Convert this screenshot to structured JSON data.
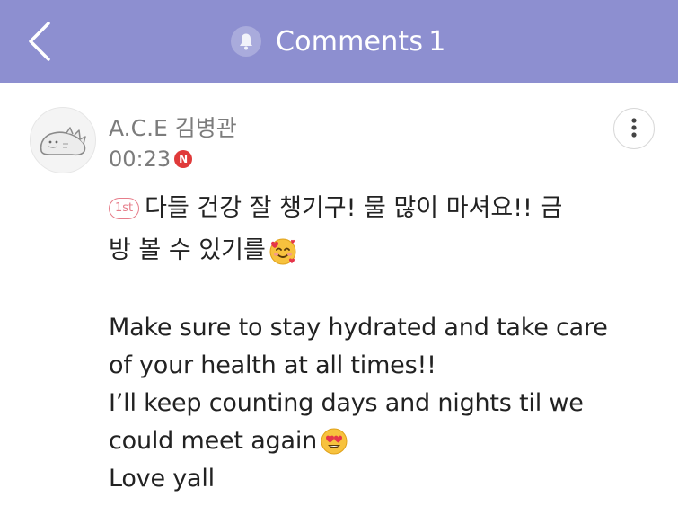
{
  "header": {
    "back_icon": "chevron-left-icon",
    "bell_icon": "bell-icon",
    "title": "Comments",
    "count": "1",
    "background": "#8d8fd0"
  },
  "comment": {
    "author": "A.C.E 김병관",
    "time": "00:23",
    "new_badge": "N",
    "more_icon": "more-vertical-icon",
    "rank_badge": "1st",
    "korean_line_1": "다들 건강 잘 챙기구! 물 많이 마셔요!! 금",
    "korean_line_2": "방 볼 수 있기를",
    "english_line_1": "Make sure to stay hydrated and take care",
    "english_line_2": "of your health at all times!!",
    "english_line_3": "I’ll keep counting days and nights til we",
    "english_line_4": "could meet again",
    "english_line_5": "Love yall",
    "emoji_1": "smiling-face-with-hearts-emoji",
    "emoji_2": "heart-eyes-emoji"
  }
}
